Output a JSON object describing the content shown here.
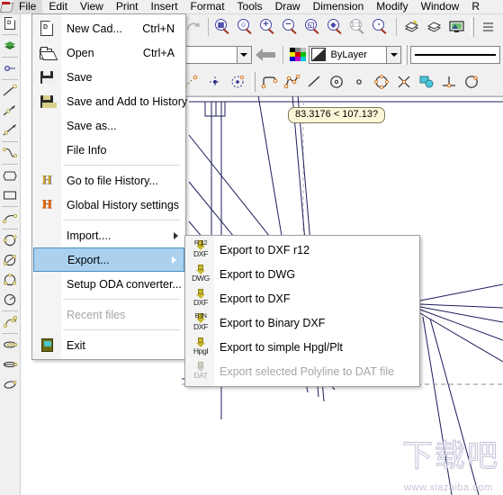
{
  "menubar": {
    "logo_icon": "app-logo-icon",
    "items": [
      {
        "label": "File",
        "active": true
      },
      {
        "label": "Edit",
        "active": false
      },
      {
        "label": "View",
        "active": false
      },
      {
        "label": "Print",
        "active": false
      },
      {
        "label": "Insert",
        "active": false
      },
      {
        "label": "Format",
        "active": false
      },
      {
        "label": "Tools",
        "active": false
      },
      {
        "label": "Draw",
        "active": false
      },
      {
        "label": "Dimension",
        "active": false
      },
      {
        "label": "Modify",
        "active": false
      },
      {
        "label": "Window",
        "active": false
      },
      {
        "label": "R",
        "active": false
      }
    ]
  },
  "file_menu": {
    "items": [
      {
        "label": "New Cad...",
        "shortcut": "Ctrl+N",
        "icon": "new-document-icon",
        "disabled": false,
        "selected": false,
        "submenu": false
      },
      {
        "label": "Open",
        "shortcut": "Ctrl+A",
        "icon": "open-folder-icon",
        "disabled": false,
        "selected": false,
        "submenu": false
      },
      {
        "label": "Save",
        "shortcut": "",
        "icon": "floppy-save-icon",
        "disabled": false,
        "selected": false,
        "submenu": false
      },
      {
        "label": "Save and Add to History",
        "shortcut": "",
        "icon": "floppy-history-icon",
        "disabled": false,
        "selected": false,
        "submenu": false
      },
      {
        "label": "Save as...",
        "shortcut": "",
        "icon": "",
        "disabled": false,
        "selected": false,
        "submenu": false
      },
      {
        "label": "File Info",
        "shortcut": "",
        "icon": "",
        "disabled": false,
        "selected": false,
        "submenu": false
      },
      {
        "divider": true
      },
      {
        "label": "Go to file History...",
        "shortcut": "",
        "icon": "history-h-yellow-icon",
        "disabled": false,
        "selected": false,
        "submenu": false
      },
      {
        "label": "Global History settings",
        "shortcut": "",
        "icon": "history-h-orange-icon",
        "disabled": false,
        "selected": false,
        "submenu": false
      },
      {
        "divider": true
      },
      {
        "label": "Import....",
        "shortcut": "",
        "icon": "",
        "disabled": false,
        "selected": false,
        "submenu": true
      },
      {
        "label": "Export...",
        "shortcut": "",
        "icon": "",
        "disabled": false,
        "selected": true,
        "submenu": true
      },
      {
        "label": "Setup ODA converter...",
        "shortcut": "",
        "icon": "",
        "disabled": false,
        "selected": false,
        "submenu": false
      },
      {
        "divider": true
      },
      {
        "label": "Recent files",
        "shortcut": "",
        "icon": "",
        "disabled": true,
        "selected": false,
        "submenu": false
      },
      {
        "divider": true
      },
      {
        "label": "Exit",
        "shortcut": "",
        "icon": "exit-door-icon",
        "disabled": false,
        "selected": false,
        "submenu": false
      }
    ]
  },
  "export_submenu": {
    "items": [
      {
        "label": "Export to DXF  r12",
        "icon_top": "R 12",
        "icon_bottom": "DXF",
        "icon": "export-dxf-r12-icon",
        "disabled": false
      },
      {
        "label": "Export to DWG",
        "icon_top": "",
        "icon_bottom": "DWG",
        "icon": "export-dwg-icon",
        "disabled": false
      },
      {
        "label": "Export to DXF",
        "icon_top": "",
        "icon_bottom": "DXF",
        "icon": "export-dxf-icon",
        "disabled": false
      },
      {
        "label": "Export to Binary DXF",
        "icon_top": "B IN",
        "icon_bottom": "DXF",
        "icon": "export-binary-dxf-icon",
        "disabled": false
      },
      {
        "label": "Export to simple Hpgl/Plt",
        "icon_top": "",
        "icon_bottom": "Hpgl",
        "icon": "export-hpgl-icon",
        "disabled": false
      },
      {
        "label": "Export selected Polyline to DAT file",
        "icon_top": "",
        "icon_bottom": "DAT",
        "icon": "export-dat-icon",
        "disabled": true
      }
    ]
  },
  "toolbar_top": {
    "buttons": [
      {
        "name": "redo-icon",
        "glyph": "redo",
        "disabled": true
      },
      {
        "name": "zoom-window-icon",
        "glyph": "window"
      },
      {
        "name": "zoom-all-icon",
        "glyph": "all"
      },
      {
        "name": "zoom-in-icon",
        "glyph": "in"
      },
      {
        "name": "zoom-out-icon",
        "glyph": "out"
      },
      {
        "name": "zoom-previous-icon",
        "glyph": "prev"
      },
      {
        "name": "zoom-extents-icon",
        "glyph": "extents"
      },
      {
        "name": "zoom-scale-icon",
        "glyph": "scale",
        "disabled": true
      },
      {
        "name": "zoom-realtime-icon",
        "glyph": "realtime"
      },
      {
        "name": "render-shade-icon",
        "glyph": "shade1"
      },
      {
        "name": "render-wire-icon",
        "glyph": "shade2"
      },
      {
        "name": "view-display-icon",
        "glyph": "monitor"
      }
    ]
  },
  "toolbar_props": {
    "layer_value": "",
    "layer_placeholder": "",
    "color_value": "ByLayer",
    "linetype_value": ""
  },
  "toolbar_draw": {
    "buttons": [
      {
        "name": "point-icon"
      },
      {
        "name": "point-snap-icon"
      },
      {
        "name": "point-ref-icon"
      },
      {
        "name": "polyline-icon"
      },
      {
        "name": "polyline-multi-icon"
      },
      {
        "name": "line-icon"
      },
      {
        "name": "circle-icon"
      },
      {
        "name": "dot-icon"
      },
      {
        "name": "polygon-icon"
      },
      {
        "name": "cross-ref-icon"
      },
      {
        "name": "hatch-fill-icon"
      },
      {
        "name": "perpendicular-icon"
      },
      {
        "name": "arc-circle-icon"
      }
    ]
  },
  "left_toolbar": {
    "buttons": [
      {
        "name": "new-file-icon"
      },
      {
        "name": "layers-icon"
      },
      {
        "name": "node-point-icon"
      },
      {
        "name": "line-draw-icon"
      },
      {
        "name": "ray-icon"
      },
      {
        "name": "xline-icon"
      },
      {
        "name": "spline-icon"
      },
      {
        "name": "polygon-shape-icon"
      },
      {
        "name": "rectangle-icon"
      },
      {
        "name": "arc-icon"
      },
      {
        "name": "circle-tool-icon"
      },
      {
        "name": "circle-2p-icon"
      },
      {
        "name": "circle-3p-icon"
      },
      {
        "name": "ellipse-arc-icon"
      },
      {
        "name": "spline-curve-icon"
      },
      {
        "name": "ellipse-icon"
      },
      {
        "name": "ellipse-flat-icon"
      },
      {
        "name": "ellipse-rot-icon"
      }
    ]
  },
  "canvas": {
    "tooltip_text": "83.3176 < 107.13?",
    "line_color": "#1c1c5a",
    "background": "#ffffff"
  },
  "watermark": {
    "text": "下载吧",
    "url": "www.xiazaiba.com"
  }
}
